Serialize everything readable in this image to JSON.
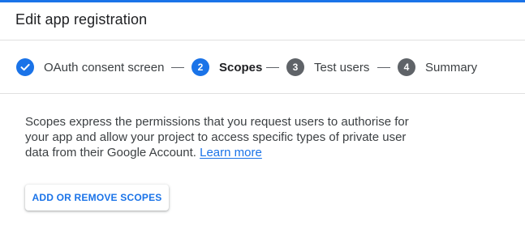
{
  "header": {
    "title": "Edit app registration"
  },
  "stepper": {
    "steps": [
      {
        "number": "",
        "label": "OAuth consent screen",
        "state": "completed",
        "icon": "check-icon"
      },
      {
        "number": "2",
        "label": "Scopes",
        "state": "active"
      },
      {
        "number": "3",
        "label": "Test users",
        "state": "pending"
      },
      {
        "number": "4",
        "label": "Summary",
        "state": "pending"
      }
    ]
  },
  "content": {
    "description": "Scopes express the permissions that you request users to authorise for your app and allow your project to access specific types of private user data from their Google Account.",
    "learn_more_label": "Learn more"
  },
  "actions": {
    "add_remove_scopes_label": "ADD OR REMOVE SCOPES"
  },
  "colors": {
    "accent": "#1a73e8",
    "pending_step": "#5f6368",
    "text": "#3c4043",
    "divider": "#e0e0e0"
  }
}
